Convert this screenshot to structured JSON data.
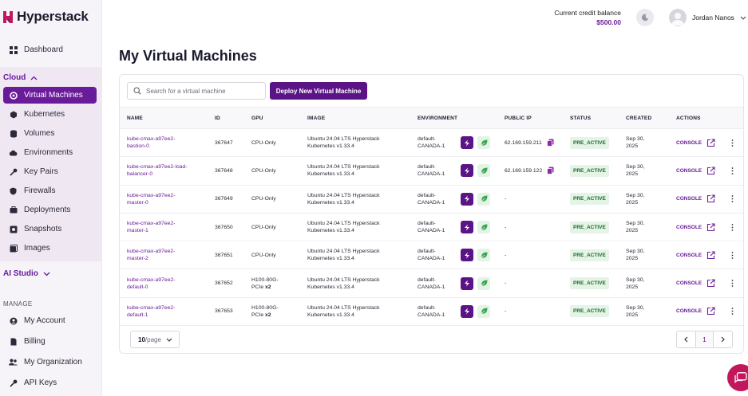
{
  "brand": {
    "name": "Hyperstack"
  },
  "sidebar": {
    "dashboard": "Dashboard",
    "cloud_label": "Cloud",
    "cloud_items": [
      "Virtual Machines",
      "Kubernetes",
      "Volumes",
      "Environments",
      "Key Pairs",
      "Firewalls",
      "Deployments",
      "Snapshots",
      "Images"
    ],
    "ai_studio_label": "AI Studio",
    "manage_label": "MANAGE",
    "manage_items": [
      "My Account",
      "Billing",
      "My Organization",
      "API Keys"
    ],
    "active_item": "Virtual Machines"
  },
  "header": {
    "credit_label": "Current credit balance",
    "credit_value": "$500.00",
    "user_name": "Jordan Nanos"
  },
  "page": {
    "title": "My Virtual Machines",
    "search_placeholder": "Search for a virtual machine",
    "deploy_button": "Deploy New Virtual Machine"
  },
  "table": {
    "columns": [
      "NAME",
      "ID",
      "GPU",
      "IMAGE",
      "ENVIRONMENT",
      "PUBLIC IP",
      "STATUS",
      "CREATED",
      "ACTIONS"
    ],
    "rows": [
      {
        "name": [
          "kube-cmax-a97ee2-",
          "bastion-0"
        ],
        "id": "367647",
        "gpu": [
          "CPU-Only",
          ""
        ],
        "image": [
          "Ubuntu 24.04 LTS Hyperstack",
          "Kubernetes v1.33.4"
        ],
        "env": [
          "default-",
          "CANADA-1"
        ],
        "ip": "62.169.159.211",
        "status": "PRE_ACTIVE",
        "created": [
          "Sep 30,",
          "2025"
        ]
      },
      {
        "name": [
          "kube-cmax-a97ee2-load-",
          "balancer-0"
        ],
        "id": "367648",
        "gpu": [
          "CPU-Only",
          ""
        ],
        "image": [
          "Ubuntu 24.04 LTS Hyperstack",
          "Kubernetes v1.33.4"
        ],
        "env": [
          "default-",
          "CANADA-1"
        ],
        "ip": "62.169.159.122",
        "status": "PRE_ACTIVE",
        "created": [
          "Sep 30,",
          "2025"
        ]
      },
      {
        "name": [
          "kube-cmax-a97ee2-",
          "master-0"
        ],
        "id": "367649",
        "gpu": [
          "CPU-Only",
          ""
        ],
        "image": [
          "Ubuntu 24.04 LTS Hyperstack",
          "Kubernetes v1.33.4"
        ],
        "env": [
          "default-",
          "CANADA-1"
        ],
        "ip": "-",
        "status": "PRE_ACTIVE",
        "created": [
          "Sep 30,",
          "2025"
        ]
      },
      {
        "name": [
          "kube-cmax-a97ee2-",
          "master-1"
        ],
        "id": "367650",
        "gpu": [
          "CPU-Only",
          ""
        ],
        "image": [
          "Ubuntu 24.04 LTS Hyperstack",
          "Kubernetes v1.33.4"
        ],
        "env": [
          "default-",
          "CANADA-1"
        ],
        "ip": "-",
        "status": "PRE_ACTIVE",
        "created": [
          "Sep 30,",
          "2025"
        ]
      },
      {
        "name": [
          "kube-cmax-a97ee2-",
          "master-2"
        ],
        "id": "367651",
        "gpu": [
          "CPU-Only",
          ""
        ],
        "image": [
          "Ubuntu 24.04 LTS Hyperstack",
          "Kubernetes v1.33.4"
        ],
        "env": [
          "default-",
          "CANADA-1"
        ],
        "ip": "-",
        "status": "PRE_ACTIVE",
        "created": [
          "Sep 30,",
          "2025"
        ]
      },
      {
        "name": [
          "kube-cmax-a97ee2-",
          "default-0"
        ],
        "id": "367652",
        "gpu": [
          "H100-80G-",
          "PCIe",
          "x2"
        ],
        "image": [
          "Ubuntu 24.04 LTS Hyperstack",
          "Kubernetes v1.33.4"
        ],
        "env": [
          "default-",
          "CANADA-1"
        ],
        "ip": "-",
        "status": "PRE_ACTIVE",
        "created": [
          "Sep 30,",
          "2025"
        ]
      },
      {
        "name": [
          "kube-cmax-a97ee2-",
          "default-1"
        ],
        "id": "367653",
        "gpu": [
          "H100-80G-",
          "PCIe",
          "x2"
        ],
        "image": [
          "Ubuntu 24.04 LTS Hyperstack",
          "Kubernetes v1.33.4"
        ],
        "env": [
          "default-",
          "CANADA-1"
        ],
        "ip": "-",
        "status": "PRE_ACTIVE",
        "created": [
          "Sep 30,",
          "2025"
        ]
      }
    ],
    "console_label": "CONSOLE"
  },
  "footer": {
    "per_page_value": "10",
    "per_page_unit": "/page",
    "current_page": "1"
  },
  "colors": {
    "brand_purple": "#6a1b9a",
    "status_green": "#1d6b2b",
    "chat_pink": "#c2185b"
  }
}
